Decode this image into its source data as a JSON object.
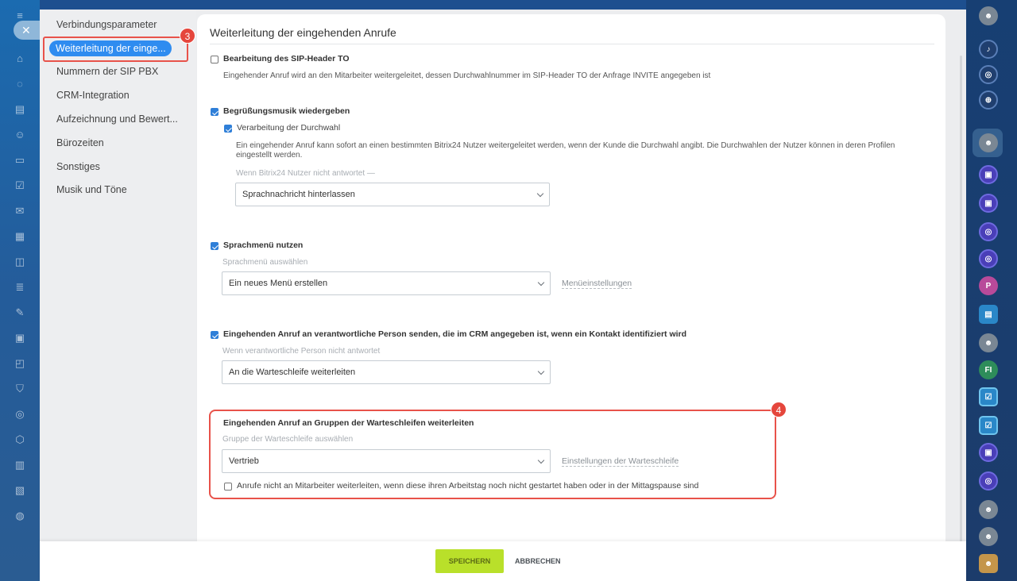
{
  "sidebar": {
    "items": [
      {
        "label": "Verbindungsparameter"
      },
      {
        "label": "Weiterleitung der einge..."
      },
      {
        "label": "Nummern der SIP PBX"
      },
      {
        "label": "CRM-Integration"
      },
      {
        "label": "Aufzeichnung und Bewert..."
      },
      {
        "label": "Bürozeiten"
      },
      {
        "label": "Sonstiges"
      },
      {
        "label": "Musik und Töne"
      }
    ],
    "active_badge": "3"
  },
  "main": {
    "title": "Weiterleitung der eingehenden Anrufe",
    "sip_header": {
      "label": "Bearbeitung des SIP-Header TO",
      "checked": false,
      "description": "Eingehender Anruf wird an den Mitarbeiter weitergeleitet, dessen Durchwahlnummer im SIP-Header TO der Anfrage INVITE angegeben ist"
    },
    "greeting": {
      "label": "Begrüßungsmusik wiedergeben",
      "checked": true,
      "extension": {
        "label": "Verarbeitung der Durchwahl",
        "checked": true,
        "description": "Ein eingehender Anruf kann sofort an einen bestimmten Bitrix24 Nutzer weitergeleitet werden, wenn der Kunde die Durchwahl angibt. Die Durchwahlen der Nutzer können in deren Profilen eingestellt werden.",
        "hint": "Wenn Bitrix24 Nutzer nicht antwortet  —",
        "select_value": "Sprachnachricht hinterlassen"
      }
    },
    "ivr": {
      "label": "Sprachmenü nutzen",
      "checked": true,
      "hint": "Sprachmenü auswählen",
      "select_value": "Ein neues Menü erstellen",
      "link": "Menüeinstellungen"
    },
    "crm": {
      "label": "Eingehenden Anruf an verantwortliche Person senden, die im CRM angegeben ist, wenn ein Kontakt identifiziert wird",
      "checked": true,
      "hint": "Wenn verantwortliche Person nicht antwortet",
      "select_value": "An die Warteschleife weiterleiten"
    },
    "queue": {
      "badge": "4",
      "label": "Eingehenden Anruf an Gruppen der Warteschleifen weiterleiten",
      "hint": "Gruppe der Warteschleife auswählen",
      "select_value": "Vertrieb",
      "link": "Einstellungen der Warteschleife",
      "option_label": "Anrufe nicht an Mitarbeiter weiterleiten, wenn diese ihren Arbeitstag noch nicht gestartet haben oder in der Mittagspause sind",
      "option_checked": false
    }
  },
  "footer": {
    "save_label": "SPEICHERN",
    "cancel_label": "ABBRECHEN"
  },
  "right_rail": {
    "items": [
      "avatar",
      "bell-icon",
      "chat-icon",
      "search-icon",
      "avatar",
      "group",
      "group",
      "chat",
      "chat",
      "P",
      "chat",
      "avatar",
      "FI",
      "task",
      "task",
      "group",
      "chat",
      "avatar",
      "avatar",
      "avatar"
    ]
  },
  "colors": {
    "accent": "#2f8cf0",
    "save_button": "#b9e02a",
    "highlight": "#e8524a"
  }
}
